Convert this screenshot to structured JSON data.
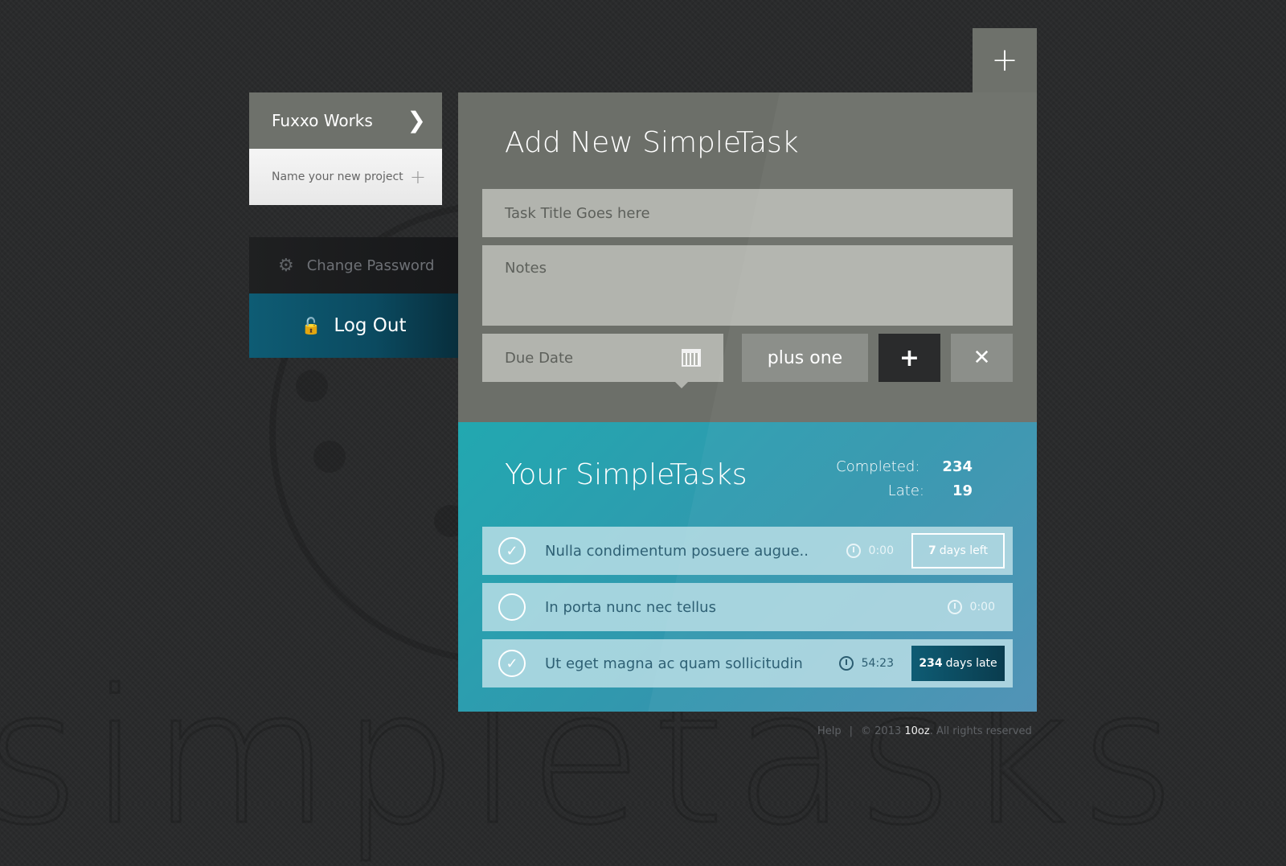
{
  "project": {
    "name": "Fuxxo Works",
    "new_project_placeholder": "Name your new project"
  },
  "account": {
    "change_password_label": "Change Password",
    "logout_label": "Log Out"
  },
  "add_task": {
    "title": "Add New SimpleTask",
    "task_title_placeholder": "Task Title Goes here",
    "notes_placeholder": "Notes",
    "due_date_placeholder": "Due Date",
    "plus_one_label": "plus one"
  },
  "task_list": {
    "title": "Your SimpleTasks",
    "stats": {
      "completed_label": "Completed:",
      "completed_value": "234",
      "late_label": "Late:",
      "late_value": "19"
    },
    "tasks": [
      {
        "text": "Nulla condimentum posuere augue..",
        "time": "0:00",
        "done": true,
        "badge_count": "7",
        "badge_text": "days left",
        "badge_type": "left"
      },
      {
        "text": "In porta nunc nec tellus",
        "time": "0:00",
        "done": false
      },
      {
        "text": "Ut eget magna ac quam sollicitudin",
        "time": "54:23",
        "done": true,
        "badge_count": "234",
        "badge_text": "days late",
        "badge_type": "late"
      }
    ]
  },
  "footer": {
    "help": "Help",
    "copyright": "© 2013",
    "brand": "10oz",
    "rights": ". All rights reserved"
  },
  "colors": {
    "panel_grey": "#6c6f69",
    "accent_teal": "#22a8b0",
    "logout_blue": "#0e5c74",
    "background": "#2a2b2c"
  },
  "icons": [
    "chevron-right-icon",
    "plus-icon",
    "gear-icon",
    "unlock-icon",
    "calendar-icon",
    "close-icon",
    "check-icon",
    "clock-icon"
  ]
}
